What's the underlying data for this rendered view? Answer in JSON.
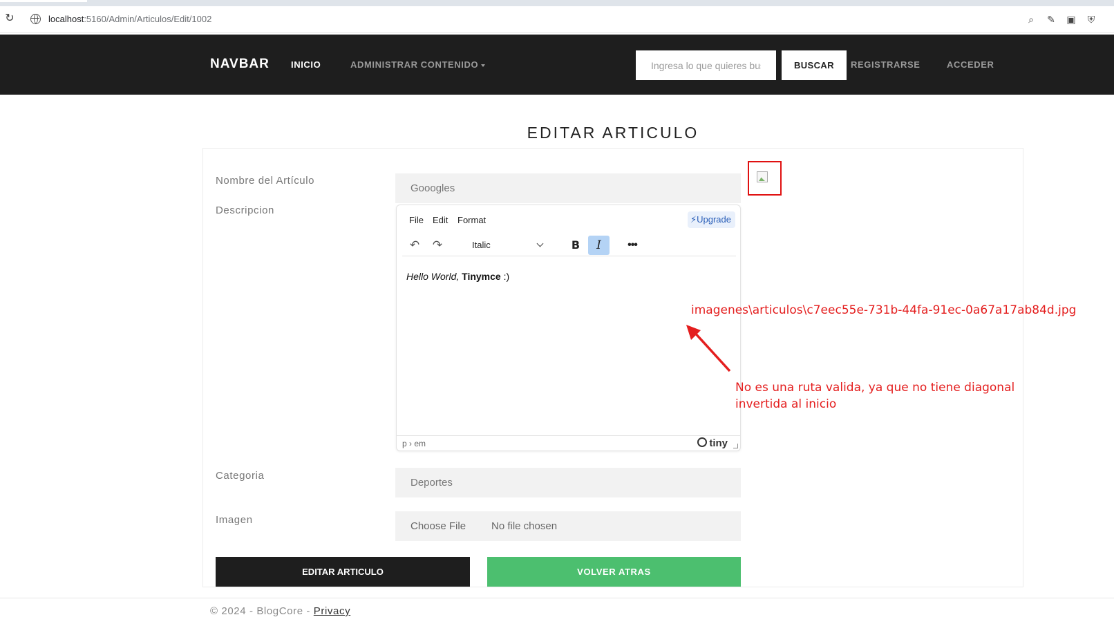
{
  "browser": {
    "url_host": "localhost",
    "url_path": ":5160/Admin/Articulos/Edit/1002"
  },
  "navbar": {
    "brand": "NAVBAR",
    "links": {
      "inicio": "INICIO",
      "administrar": "ADMINISTRAR CONTENIDO",
      "registrarse": "REGISTRARSE",
      "acceder": "ACCEDER"
    },
    "search_placeholder": "Ingresa lo que quieres buscar",
    "search_button": "BUSCAR"
  },
  "page": {
    "title": "EDITAR ARTICULO"
  },
  "form": {
    "nombre_label": "Nombre del Artículo",
    "nombre_value": "Gooogles",
    "descripcion_label": "Descripcion",
    "categoria_label": "Categoria",
    "categoria_value": "Deportes",
    "imagen_label": "Imagen",
    "file_button": "Choose File",
    "file_status": "No file chosen",
    "submit_button": "EDITAR ARTICULO",
    "back_button": "VOLVER ATRAS"
  },
  "editor": {
    "menu": [
      "File",
      "Edit",
      "Format"
    ],
    "upgrade": "Upgrade",
    "format_value": "Italic",
    "bold_glyph": "B",
    "italic_glyph": "I",
    "more_glyph": "•••",
    "content_italic": "Hello World,",
    "content_bold": "Tinymce",
    "content_rest": " :)",
    "status_path": "p › em",
    "logo": "tiny"
  },
  "annotations": {
    "path": "imagenes\\articulos\\c7eec55e-731b-44fa-91ec-0a67a17ab84d.jpg",
    "note": "No es una ruta valida, ya que no tiene diagonal invertida al inicio",
    "color": "#e41e1e"
  },
  "footer": {
    "text": "© 2024 - BlogCore - ",
    "privacy": "Privacy"
  },
  "colors": {
    "navbar_bg": "#1e1e1e",
    "back_button": "#4cbf6f",
    "italic_active": "#b4d3f5"
  }
}
